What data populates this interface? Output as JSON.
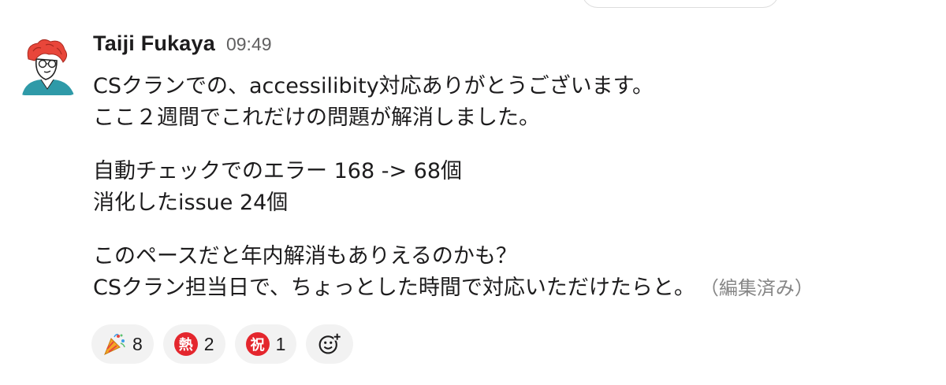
{
  "message": {
    "author": "Taiji Fukaya",
    "timestamp": "09:49",
    "lines": [
      "CSクランでの、accessilibity対応ありがとうございます。",
      "ここ２週間でこれだけの問題が解消しました。",
      "自動チェックでのエラー 168 -> 68個",
      "消化したissue 24個",
      "このペースだと年内解消もありえるのかも？",
      "CSクラン担当日で、ちょっとした時間で対応いただけたらと。"
    ],
    "edited_label": "（編集済み）"
  },
  "reactions": [
    {
      "icon": "party-popper-icon",
      "count": "8"
    },
    {
      "icon": "kanji-badge-icon",
      "glyph": "熱",
      "count": "2"
    },
    {
      "icon": "kanji-badge-icon",
      "glyph": "祝",
      "count": "1"
    }
  ],
  "colors": {
    "text": "#1d1c1d",
    "timestamp": "#616061",
    "edited": "#868686",
    "reaction_bg": "#f2f2f2",
    "badge_red": "#e4262d"
  }
}
